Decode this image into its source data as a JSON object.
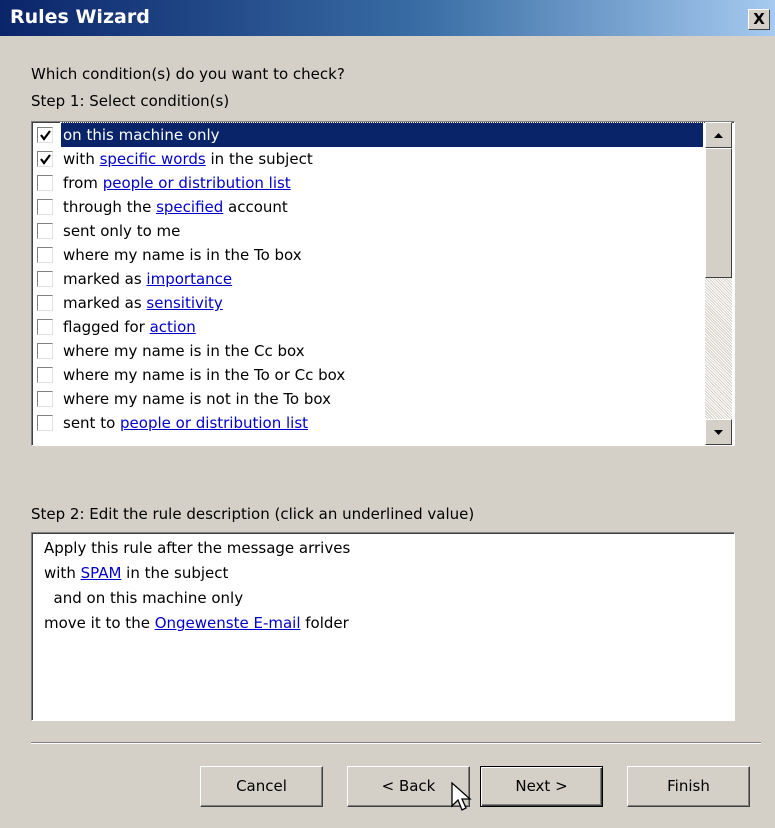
{
  "window": {
    "title": "Rules Wizard",
    "close_label": "X"
  },
  "step1": {
    "question": "Which condition(s) do you want to check?",
    "label": "Step 1: Select condition(s)"
  },
  "conditions": [
    {
      "parts": [
        {
          "t": "on this machine only"
        }
      ],
      "checked": true,
      "selected": true
    },
    {
      "parts": [
        {
          "t": "with "
        },
        {
          "t": "specific words",
          "link": true
        },
        {
          "t": " in the subject"
        }
      ],
      "checked": true,
      "selected": false
    },
    {
      "parts": [
        {
          "t": "from "
        },
        {
          "t": "people or distribution list",
          "link": true
        }
      ],
      "checked": false,
      "selected": false
    },
    {
      "parts": [
        {
          "t": "through the "
        },
        {
          "t": "specified",
          "link": true
        },
        {
          "t": " account"
        }
      ],
      "checked": false,
      "selected": false
    },
    {
      "parts": [
        {
          "t": "sent only to me"
        }
      ],
      "checked": false,
      "selected": false
    },
    {
      "parts": [
        {
          "t": "where my name is in the To box"
        }
      ],
      "checked": false,
      "selected": false
    },
    {
      "parts": [
        {
          "t": "marked as "
        },
        {
          "t": "importance",
          "link": true
        }
      ],
      "checked": false,
      "selected": false
    },
    {
      "parts": [
        {
          "t": "marked as "
        },
        {
          "t": "sensitivity",
          "link": true
        }
      ],
      "checked": false,
      "selected": false
    },
    {
      "parts": [
        {
          "t": "flagged for "
        },
        {
          "t": "action",
          "link": true
        }
      ],
      "checked": false,
      "selected": false
    },
    {
      "parts": [
        {
          "t": "where my name is in the Cc box"
        }
      ],
      "checked": false,
      "selected": false
    },
    {
      "parts": [
        {
          "t": "where my name is in the To or Cc box"
        }
      ],
      "checked": false,
      "selected": false
    },
    {
      "parts": [
        {
          "t": "where my name is not in the To box"
        }
      ],
      "checked": false,
      "selected": false
    },
    {
      "parts": [
        {
          "t": "sent to "
        },
        {
          "t": "people or distribution list",
          "link": true
        }
      ],
      "checked": false,
      "selected": false
    }
  ],
  "step2": {
    "label": "Step 2: Edit the rule description (click an underlined value)",
    "lines": [
      [
        {
          "t": "Apply this rule after the message arrives"
        }
      ],
      [
        {
          "t": "with "
        },
        {
          "t": "SPAM",
          "link": true
        },
        {
          "t": " in the subject"
        }
      ],
      [
        {
          "t": "  and on this machine only"
        }
      ],
      [
        {
          "t": "move it to the "
        },
        {
          "t": "Ongewenste E-mail",
          "link": true
        },
        {
          "t": " folder"
        }
      ]
    ]
  },
  "buttons": {
    "cancel": "Cancel",
    "back": "< Back",
    "next": "Next >",
    "finish": "Finish"
  },
  "colors": {
    "title_gradient_start": "#0a246a",
    "title_gradient_end": "#a6caf0",
    "link": "#0000cc",
    "selection": "#0a246a",
    "dialog_face": "#d4d0c8"
  }
}
